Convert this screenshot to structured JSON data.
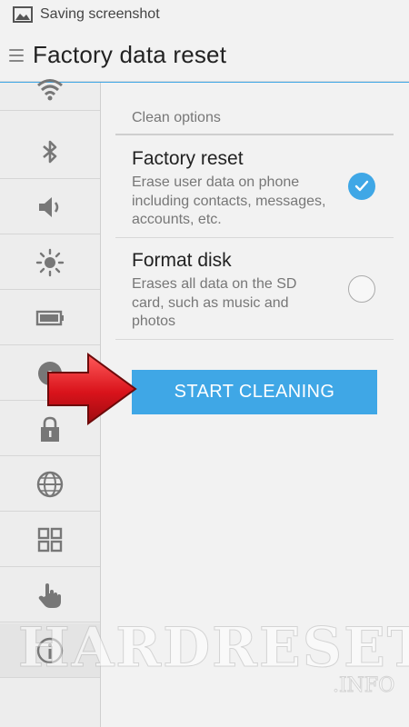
{
  "status_bar": {
    "text": "Saving screenshot",
    "icon": "image-icon"
  },
  "app_bar": {
    "title": "Factory data reset",
    "accent_color": "#3fa7e6"
  },
  "sidebar": {
    "items": [
      {
        "icon": "wifi-icon"
      },
      {
        "icon": "bluetooth-icon"
      },
      {
        "icon": "volume-icon"
      },
      {
        "icon": "brightness-icon"
      },
      {
        "icon": "battery-icon"
      },
      {
        "icon": "storage-icon"
      },
      {
        "icon": "lock-icon"
      },
      {
        "icon": "globe-icon"
      },
      {
        "icon": "apps-grid-icon"
      },
      {
        "icon": "gesture-hand-icon"
      },
      {
        "icon": "info-icon"
      }
    ]
  },
  "main": {
    "section_label": "Clean options",
    "options": [
      {
        "title": "Factory reset",
        "description": "Erase user data on phone including contacts, messages, accounts, etc.",
        "checked": true
      },
      {
        "title": "Format disk",
        "description": "Erases all data on the SD card, such as music and photos",
        "checked": false
      }
    ],
    "start_button": "START CLEANING"
  },
  "watermark": {
    "text": "HARDRESET",
    "sub": ".INFO"
  },
  "colors": {
    "accent": "#3fa7e6",
    "arrow": "#d9131b"
  }
}
